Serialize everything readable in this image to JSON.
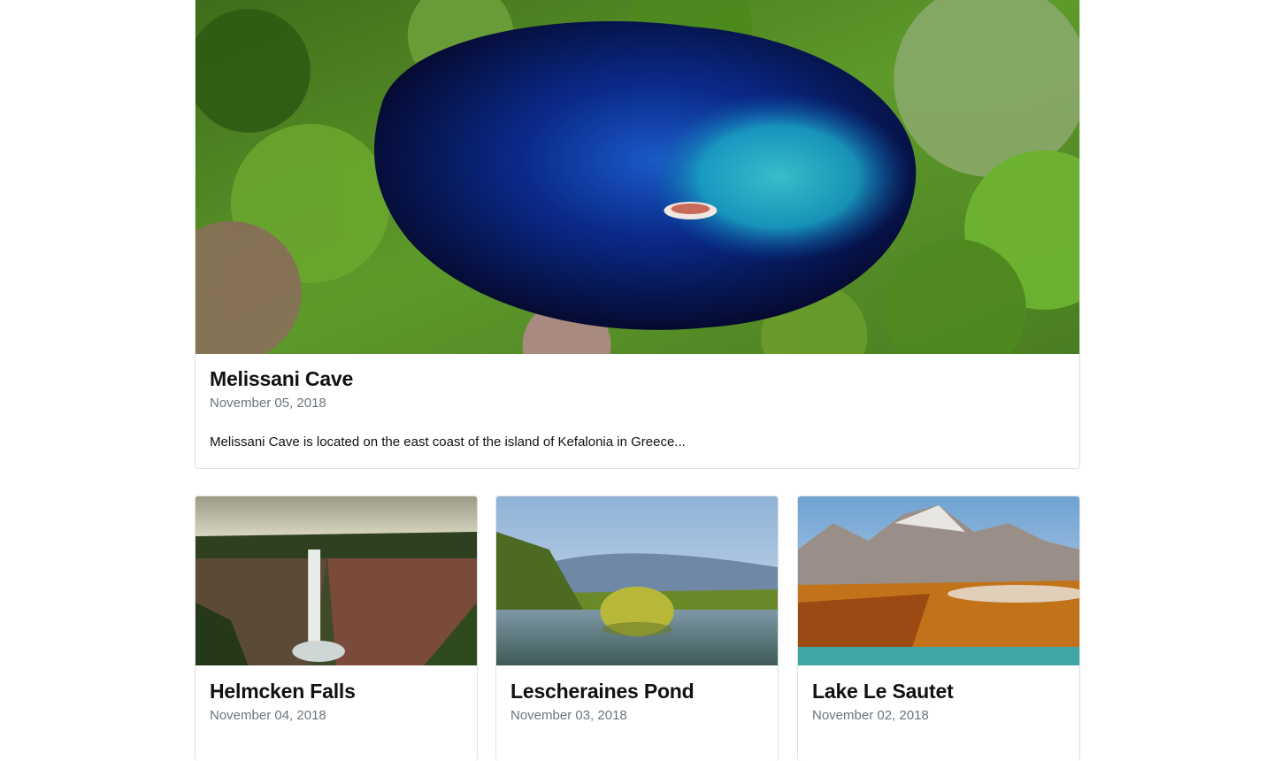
{
  "featured": {
    "title": "Melissani Cave",
    "date": "November 05, 2018",
    "excerpt": "Melissani Cave is located on the east coast of the island of Kefalonia in Greece..."
  },
  "posts": [
    {
      "title": "Helmcken Falls",
      "date": "November 04, 2018"
    },
    {
      "title": "Lescheraines Pond",
      "date": "November 03, 2018"
    },
    {
      "title": "Lake Le Sautet",
      "date": "November 02, 2018"
    }
  ]
}
